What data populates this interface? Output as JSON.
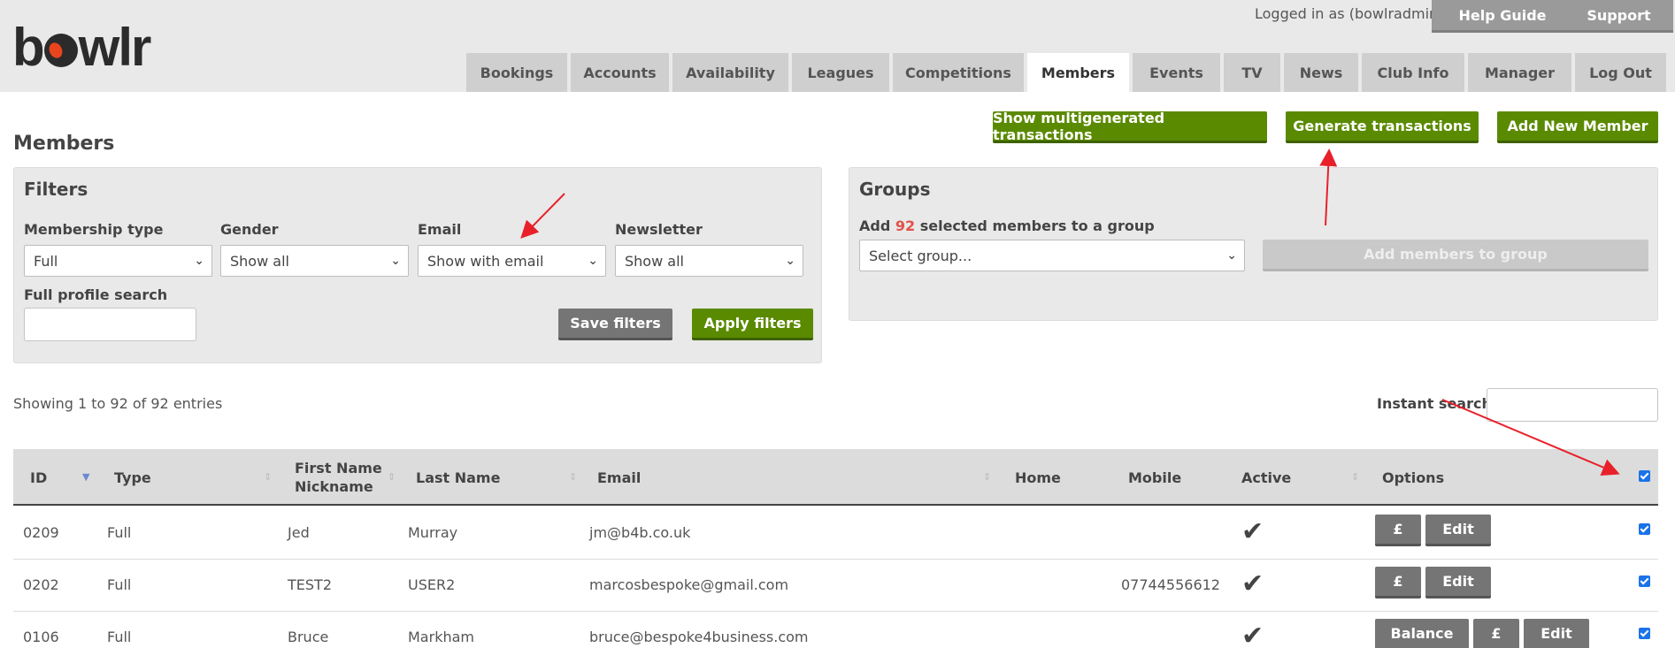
{
  "app": {
    "logo": "bowlr"
  },
  "header": {
    "logged_in": "Logged in as (bowlradmin)",
    "help_guide": "Help Guide",
    "support": "Support",
    "tabs": [
      {
        "label": "Bookings"
      },
      {
        "label": "Accounts"
      },
      {
        "label": "Availability"
      },
      {
        "label": "Leagues"
      },
      {
        "label": "Competitions"
      },
      {
        "label": "Members",
        "active": true
      },
      {
        "label": "Events"
      },
      {
        "label": "TV"
      },
      {
        "label": "News"
      },
      {
        "label": "Club Info"
      },
      {
        "label": "Manager"
      },
      {
        "label": "Log Out"
      }
    ]
  },
  "page": {
    "title": "Members",
    "actions": {
      "show_multi": "Show multigenerated transactions",
      "generate": "Generate transactions",
      "add_member": "Add New Member"
    }
  },
  "filters": {
    "title": "Filters",
    "membership_label": "Membership type",
    "membership_value": "Full",
    "gender_label": "Gender",
    "gender_value": "Show all",
    "email_label": "Email",
    "email_value": "Show with email",
    "newsletter_label": "Newsletter",
    "newsletter_value": "Show all",
    "search_label": "Full profile search",
    "search_value": "",
    "save": "Save filters",
    "apply": "Apply filters"
  },
  "groups": {
    "title": "Groups",
    "add_prefix": "Add",
    "count": "92",
    "add_suffix": "selected members to a group",
    "select_value": "Select group...",
    "add_button": "Add members to group"
  },
  "table": {
    "showing": "Showing 1 to 92 of 92 entries",
    "search_label": "Instant search:",
    "search_value": "",
    "headers": {
      "id": "ID",
      "type": "Type",
      "first_name": "First Name",
      "nickname": "Nickname",
      "last_name": "Last Name",
      "email": "Email",
      "home": "Home",
      "mobile": "Mobile",
      "active": "Active",
      "options": "Options"
    },
    "rows": [
      {
        "id": "0209",
        "type": "Full",
        "first": "Jed",
        "last": "Murray",
        "email": "jm@b4b.co.uk",
        "home": "",
        "mobile": "",
        "balance": "",
        "pound": "£",
        "edit": "Edit"
      },
      {
        "id": "0202",
        "type": "Full",
        "first": "TEST2",
        "last": "USER2",
        "email": "marcosbespoke@gmail.com",
        "home": "",
        "mobile": "07744556612",
        "balance": "",
        "pound": "£",
        "edit": "Edit"
      },
      {
        "id": "0106",
        "type": "Full",
        "first": "Bruce",
        "last": "Markham",
        "email": "bruce@bespoke4business.com",
        "home": "",
        "mobile": "",
        "balance": "Balance",
        "pound": "£",
        "edit": "Edit"
      }
    ]
  },
  "colors": {
    "accent_green": "#5a8a00",
    "annotation_red": "#e8202a"
  }
}
